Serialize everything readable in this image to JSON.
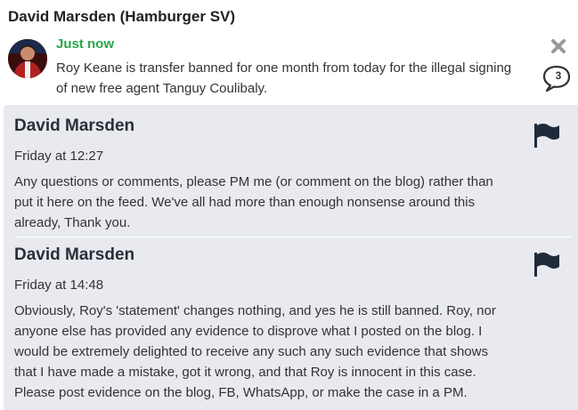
{
  "header": {
    "title": "David Marsden (Hamburger SV)"
  },
  "post": {
    "time": "Just now",
    "text": "Roy Keane is transfer banned for one month from today for the illegal signing of new free agent Tanguy Coulibaly.",
    "comment_count": "3"
  },
  "comments": [
    {
      "author": "David Marsden",
      "time": "Friday at 12:27",
      "text": "Any questions or comments, please PM me (or comment on the blog) rather than put it here on the feed. We've all had more than enough nonsense around this already, Thank you."
    },
    {
      "author": "David Marsden",
      "time": "Friday at 14:48",
      "text": "Obviously, Roy's 'statement' changes nothing, and yes he is still banned. Roy, nor anyone else has provided any evidence to disprove what I posted on the blog. I would be extremely delighted to receive any such any such evidence that shows that I have made a mistake, got it wrong, and that Roy is innocent in this case. Please post evidence on the blog, FB, WhatsApp, or make the case in a PM."
    }
  ],
  "colors": {
    "time_green": "#27a745",
    "comments_bg": "#e8eaf0"
  },
  "icons": [
    "close-icon",
    "comment-bubble-icon",
    "flag-icon"
  ]
}
